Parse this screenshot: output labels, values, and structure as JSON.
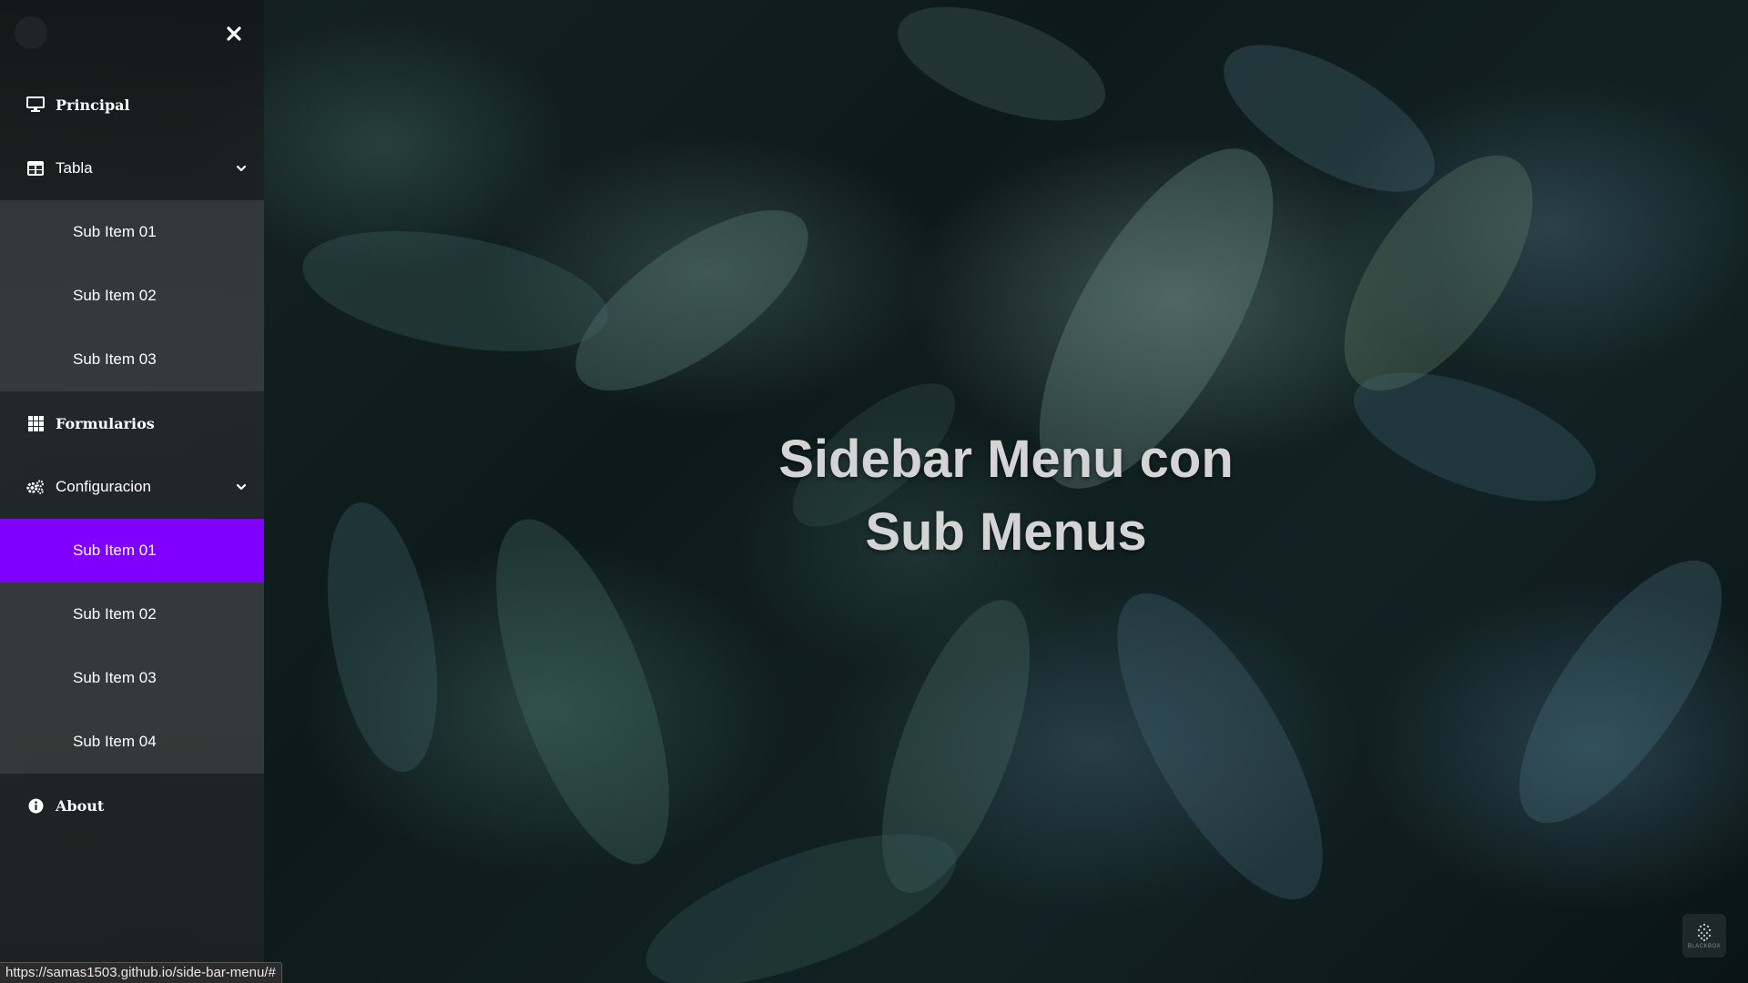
{
  "hero": {
    "title_line1": "Sidebar Menu con",
    "title_line2": "Sub Menus"
  },
  "sidebar": {
    "close_icon": "close-icon",
    "items": [
      {
        "label": "Principal",
        "icon": "desktop-icon"
      },
      {
        "label": "Tabla",
        "icon": "table-icon",
        "expanded": true,
        "sub_items": [
          {
            "label": "Sub Item 01"
          },
          {
            "label": "Sub Item 02"
          },
          {
            "label": "Sub Item 03"
          }
        ]
      },
      {
        "label": "Formularios",
        "icon": "grid-icon"
      },
      {
        "label": "Configuracion",
        "icon": "cogs-icon",
        "expanded": true,
        "sub_items": [
          {
            "label": "Sub Item 01",
            "active": true
          },
          {
            "label": "Sub Item 02"
          },
          {
            "label": "Sub Item 03"
          },
          {
            "label": "Sub Item 04"
          }
        ]
      },
      {
        "label": "About",
        "icon": "info-icon"
      }
    ]
  },
  "status_bar": {
    "url": "https://samas1503.github.io/side-bar-menu/#"
  },
  "badge": {
    "label": "BLACKBOX",
    "icon": "blackbox-icon"
  },
  "colors": {
    "accent": "#7f00ff",
    "text": "#ffffff",
    "hero_text": "#d4d4d4"
  }
}
